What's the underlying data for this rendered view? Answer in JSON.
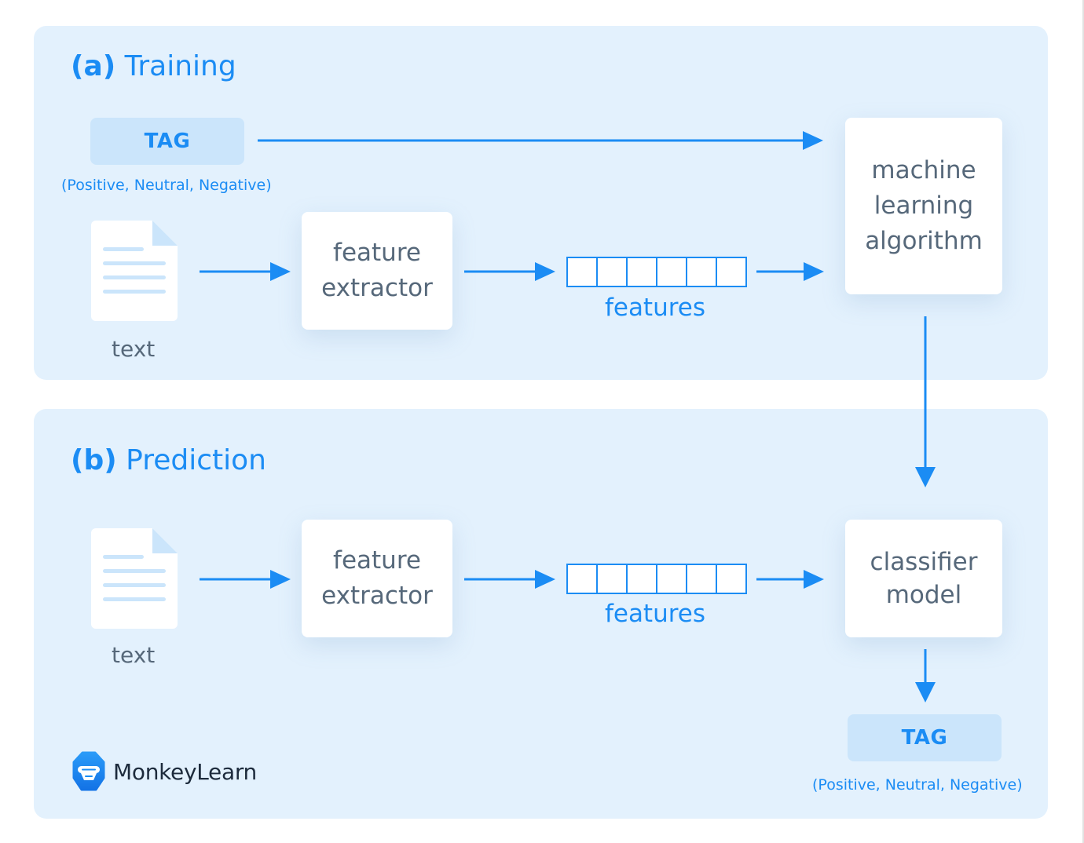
{
  "training": {
    "label_letter": "(a)",
    "label_word": "Training",
    "tag": "TAG",
    "tag_options": "(Positive, Neutral, Negative)",
    "doc_label": "text",
    "extractor": [
      "feature",
      "extractor"
    ],
    "features_label": "features",
    "features_cells": 6,
    "algorithm": [
      "machine",
      "learning",
      "algorithm"
    ]
  },
  "prediction": {
    "label_letter": "(b)",
    "label_word": "Prediction",
    "doc_label": "text",
    "extractor": [
      "feature",
      "extractor"
    ],
    "features_label": "features",
    "features_cells": 6,
    "model": [
      "classifier",
      "model"
    ],
    "tag": "TAG",
    "tag_options": "(Positive, Neutral, Negative)"
  },
  "brand": {
    "name": "MonkeyLearn",
    "icon": "monkey-head-icon"
  },
  "colors": {
    "accent": "#1b8cf4",
    "panel_bg": "#e3f1fd",
    "tag_bg": "#cbe5fb",
    "box_text": "#56687a",
    "doc_lines": "#cbe5fb"
  }
}
